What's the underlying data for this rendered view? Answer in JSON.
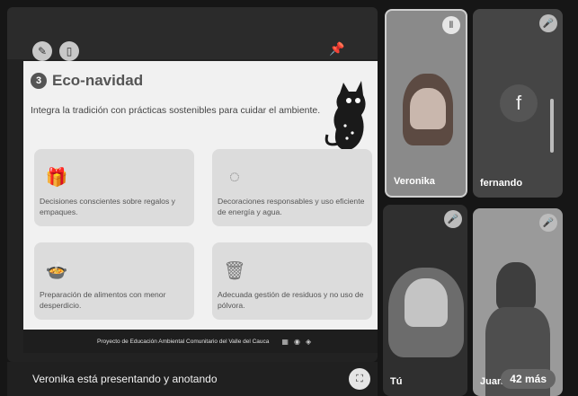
{
  "slide": {
    "number": "3",
    "title": "Eco-navidad",
    "intro": "Integra la tradición con prácticas sostenibles para cuidar el ambiente.",
    "cards": [
      {
        "icon": "gift-icon",
        "glyph": "🎁",
        "text": "Decisiones conscientes sobre regalos y empaques."
      },
      {
        "icon": "wreath-icon",
        "glyph": "◌",
        "text": "Decoraciones responsables y uso eficiente de energía y agua."
      },
      {
        "icon": "food-icon",
        "glyph": "🍲",
        "text": "Preparación de alimentos con menor desperdicio."
      },
      {
        "icon": "recycle-bin-icon",
        "glyph": "🗑",
        "text": "Adecuada gestión de residuos y no uso de pólvora."
      }
    ],
    "footer": "Proyecto de Educación Ambiental Comunitario del Valle del Cauca"
  },
  "presenter_bar": {
    "text": "Veronika está presentando y anotando"
  },
  "participants": {
    "veronika": {
      "name": "Veronika"
    },
    "fernando": {
      "name": "fernando",
      "initial": "f"
    },
    "tu": {
      "name": "Tú"
    },
    "juan": {
      "name": "Juan"
    },
    "more": "42 más"
  },
  "colors": {
    "background": "#161616",
    "tile": "#3a3a3a",
    "slide_bg": "#f1f1f1",
    "card_bg": "#dcdcdc"
  }
}
